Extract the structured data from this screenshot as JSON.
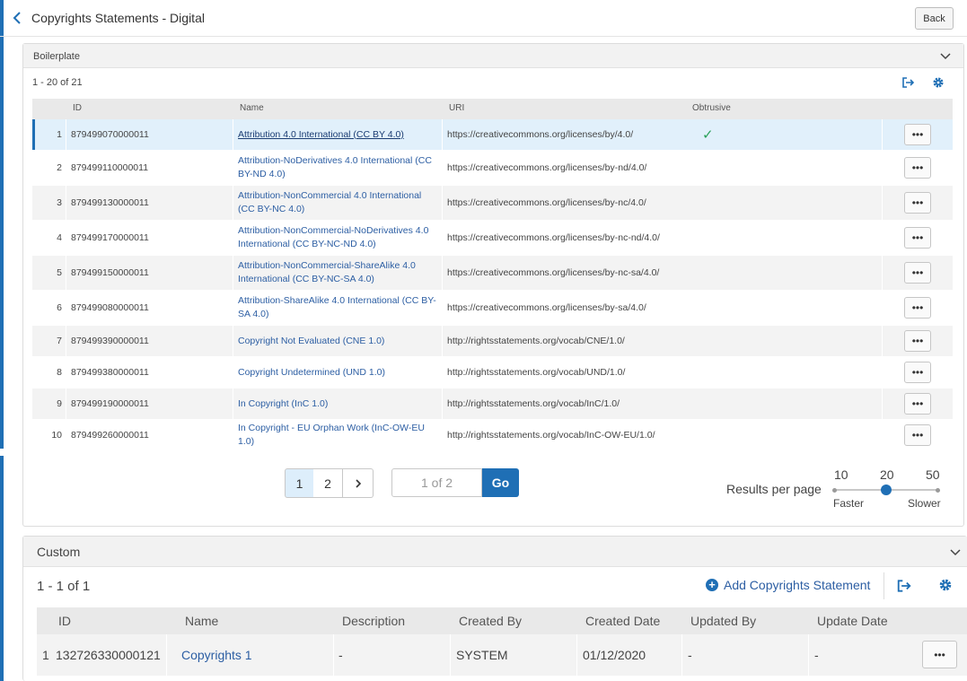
{
  "header": {
    "title": "Copyrights Statements - Digital",
    "back_label": "Back"
  },
  "boilerplate": {
    "title": "Boilerplate",
    "count": "1 - 20 of 21",
    "columns": {
      "id": "ID",
      "name": "Name",
      "uri": "URI",
      "obtrusive": "Obtrusive"
    },
    "rows": [
      {
        "num": "1",
        "id": "879499070000011",
        "name": "Attribution 4.0 International (CC BY 4.0)",
        "uri": "https://creativecommons.org/licenses/by/4.0/",
        "obtrusive": "✓"
      },
      {
        "num": "2",
        "id": "879499110000011",
        "name": "Attribution-NoDerivatives 4.0 International (CC BY-ND 4.0)",
        "uri": "https://creativecommons.org/licenses/by-nd/4.0/",
        "obtrusive": ""
      },
      {
        "num": "3",
        "id": "879499130000011",
        "name": "Attribution-NonCommercial 4.0 International (CC BY-NC 4.0)",
        "uri": "https://creativecommons.org/licenses/by-nc/4.0/",
        "obtrusive": ""
      },
      {
        "num": "4",
        "id": "879499170000011",
        "name": "Attribution-NonCommercial-NoDerivatives 4.0 International (CC BY-NC-ND 4.0)",
        "uri": "https://creativecommons.org/licenses/by-nc-nd/4.0/",
        "obtrusive": ""
      },
      {
        "num": "5",
        "id": "879499150000011",
        "name": "Attribution-NonCommercial-ShareAlike 4.0 International (CC BY-NC-SA 4.0)",
        "uri": "https://creativecommons.org/licenses/by-nc-sa/4.0/",
        "obtrusive": ""
      },
      {
        "num": "6",
        "id": "879499080000011",
        "name": "Attribution-ShareAlike 4.0 International (CC BY-SA 4.0)",
        "uri": "https://creativecommons.org/licenses/by-sa/4.0/",
        "obtrusive": ""
      },
      {
        "num": "7",
        "id": "879499390000011",
        "name": "Copyright Not Evaluated (CNE 1.0)",
        "uri": "http://rightsstatements.org/vocab/CNE/1.0/",
        "obtrusive": ""
      },
      {
        "num": "8",
        "id": "879499380000011",
        "name": "Copyright Undetermined (UND 1.0)",
        "uri": "http://rightsstatements.org/vocab/UND/1.0/",
        "obtrusive": ""
      },
      {
        "num": "9",
        "id": "879499190000011",
        "name": "In Copyright (InC 1.0)",
        "uri": "http://rightsstatements.org/vocab/InC/1.0/",
        "obtrusive": ""
      },
      {
        "num": "10",
        "id": "879499260000011",
        "name": "In Copyright - EU Orphan Work (InC-OW-EU 1.0)",
        "uri": "http://rightsstatements.org/vocab/InC-OW-EU/1.0/",
        "obtrusive": ""
      }
    ],
    "more_label": "•••"
  },
  "pagination": {
    "pages": [
      "1",
      "2"
    ],
    "active_page": "1",
    "next_label": "›",
    "page_input_value": "1 of 2",
    "go_label": "Go"
  },
  "results_per_page": {
    "label": "Results per page",
    "options": [
      "10",
      "20",
      "50"
    ],
    "selected": "20",
    "faster_label": "Faster",
    "slower_label": "Slower"
  },
  "custom": {
    "title": "Custom",
    "count": "1 - 1 of 1",
    "add_label": "Add Copyrights Statement",
    "columns": {
      "id": "ID",
      "name": "Name",
      "description": "Description",
      "created_by": "Created By",
      "created_date": "Created Date",
      "updated_by": "Updated By",
      "update_date": "Update Date"
    },
    "rows": [
      {
        "num": "1",
        "id": "132726330000121",
        "name": "Copyrights 1",
        "description": "-",
        "created_by": "SYSTEM",
        "created_date": "01/12/2020",
        "updated_by": "-",
        "update_date": "-"
      }
    ],
    "more_label": "•••"
  },
  "colors": {
    "accent": "#1f6fb5",
    "link": "#2c5ea3",
    "check": "#2aa15a",
    "selected_row": "#e1f0fb"
  }
}
